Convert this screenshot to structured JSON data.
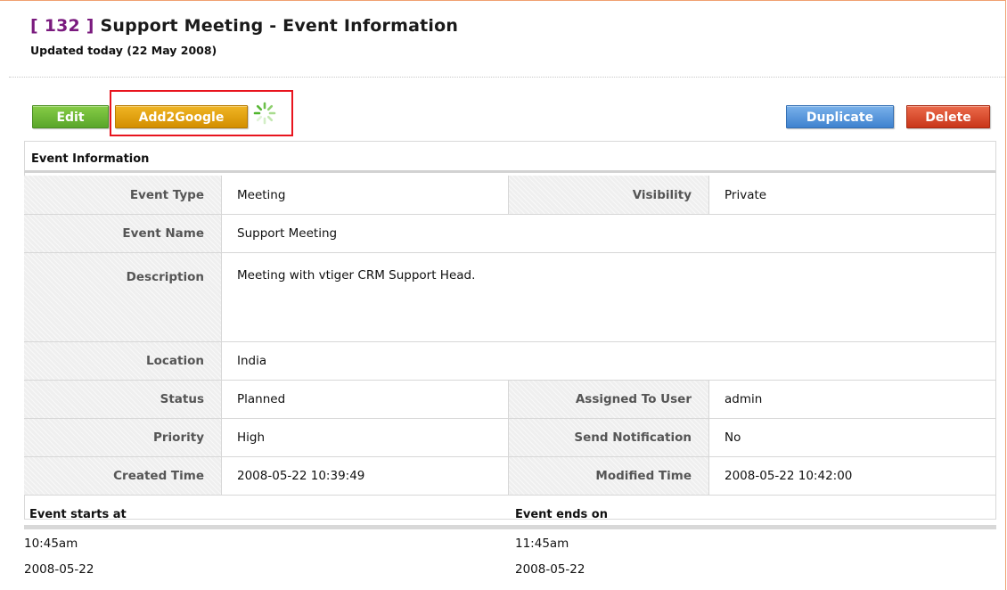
{
  "header": {
    "record_id": "[ 132 ]",
    "title": "Support Meeting - Event Information",
    "updated": "Updated today (22 May 2008)"
  },
  "toolbar": {
    "edit_label": "Edit",
    "add2google_label": "Add2Google",
    "duplicate_label": "Duplicate",
    "delete_label": "Delete"
  },
  "section": {
    "title": "Event Information"
  },
  "fields": {
    "event_type_label": "Event Type",
    "event_type_value": "Meeting",
    "visibility_label": "Visibility",
    "visibility_value": "Private",
    "event_name_label": "Event Name",
    "event_name_value": "Support Meeting",
    "description_label": "Description",
    "description_value": "Meeting with vtiger CRM Support Head.",
    "location_label": "Location",
    "location_value": "India",
    "status_label": "Status",
    "status_value": "Planned",
    "assigned_label": "Assigned To User",
    "assigned_value": "admin",
    "priority_label": "Priority",
    "priority_value": "High",
    "notification_label": "Send Notification",
    "notification_value": "No",
    "created_label": "Created Time",
    "created_value": "2008-05-22 10:39:49",
    "modified_label": "Modified Time",
    "modified_value": "2008-05-22 10:42:00"
  },
  "times": {
    "start_label": "Event starts at",
    "start_time": "10:45am",
    "start_date": "2008-05-22",
    "end_label": "Event ends on",
    "end_time": "11:45am",
    "end_date": "2008-05-22"
  },
  "icons": {
    "spinner": "loading-spinner-icon"
  },
  "colors": {
    "edit": "#5aa62a",
    "add2google": "#d38f00",
    "duplicate": "#3f82cf",
    "delete": "#c9361a",
    "highlight": "#e8141e",
    "record_id": "#7a1a7e"
  }
}
